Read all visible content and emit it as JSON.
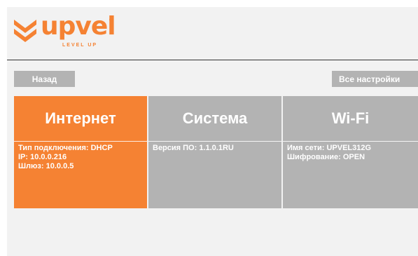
{
  "brand": {
    "name": "upvel",
    "registered": "®",
    "tagline": "LEVEL UP",
    "color": "#f58233"
  },
  "nav": {
    "back_label": "Назад",
    "all_settings_label": "Все настройки"
  },
  "tiles": [
    {
      "title": "Интернет",
      "active": true,
      "info": [
        "Тип подключения: DHCP",
        "IP: 10.0.0.216",
        "Шлюз: 10.0.0.5"
      ]
    },
    {
      "title": "Система",
      "active": false,
      "info": [
        "Версия ПО: 1.1.0.1RU"
      ]
    },
    {
      "title": "Wi-Fi",
      "active": false,
      "info": [
        "Имя сети: UPVEL312G",
        "Шифрование: OPEN"
      ]
    }
  ],
  "colors": {
    "accent": "#f58233",
    "tile_inactive": "#b3b3b3",
    "background": "#f2f2f2"
  }
}
